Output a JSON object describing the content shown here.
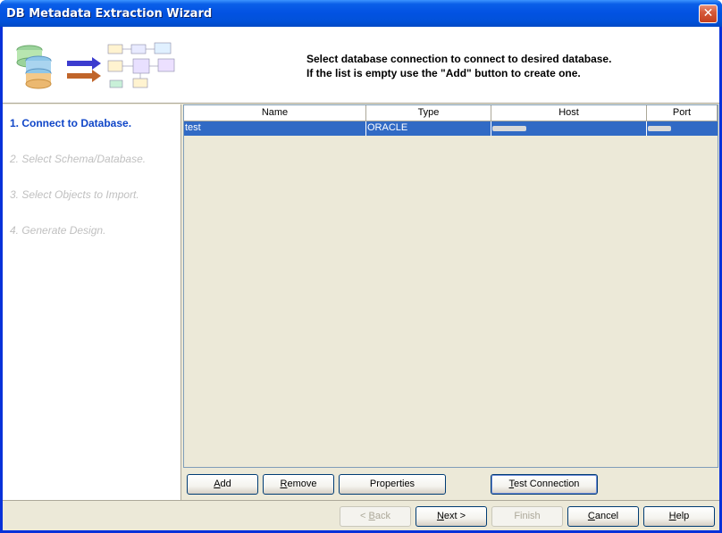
{
  "window": {
    "title": "DB Metadata Extraction Wizard",
    "close_label": "✕"
  },
  "header": {
    "message_line1": "Select database connection to connect to desired database.",
    "message_line2": "If the list is empty use the \"Add\" button to create one."
  },
  "steps": [
    {
      "label": "1. Connect to Database.",
      "state": "active"
    },
    {
      "label": "2. Select Schema/Database.",
      "state": "inactive"
    },
    {
      "label": "3. Select Objects to Import.",
      "state": "inactive"
    },
    {
      "label": "4. Generate Design.",
      "state": "inactive"
    }
  ],
  "table": {
    "columns": [
      "Name",
      "Type",
      "Host",
      "Port"
    ],
    "rows": [
      {
        "name": "test",
        "type": "ORACLE",
        "host": "",
        "port": "",
        "selected": true
      }
    ]
  },
  "list_buttons": {
    "add": {
      "mnemonic": "A",
      "rest": "dd"
    },
    "remove": {
      "mnemonic": "R",
      "rest": "emove"
    },
    "properties": {
      "label": "Properties"
    },
    "test_connection": {
      "mnemonic": "T",
      "rest": "est Connection"
    }
  },
  "nav_buttons": {
    "back": {
      "prefix": "< ",
      "mnemonic": "B",
      "rest": "ack"
    },
    "next": {
      "mnemonic": "N",
      "rest": "ext >"
    },
    "finish": {
      "label": "Finish"
    },
    "cancel": {
      "mnemonic": "C",
      "rest": "ancel"
    },
    "help": {
      "mnemonic": "H",
      "rest": "elp"
    }
  },
  "colors": {
    "title_bar": "#0353e3",
    "selection": "#316ac5",
    "active_step": "#1046c8",
    "inactive_step": "#c0c0c0"
  },
  "icons": [
    "database-stack-icon",
    "arrow-icons",
    "diagram-icon",
    "close-icon"
  ]
}
